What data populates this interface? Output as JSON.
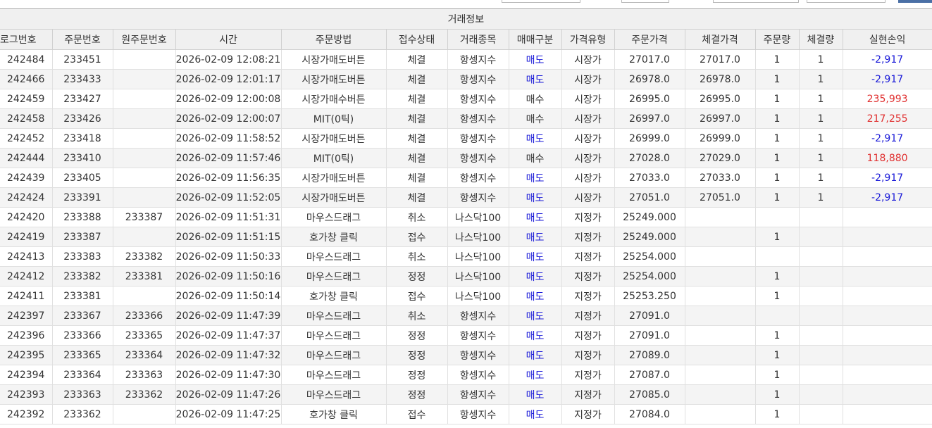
{
  "group_header": "거래정보",
  "columns": [
    "로그번호",
    "주문번호",
    "원주문번호",
    "시간",
    "주문방법",
    "접수상태",
    "거래종목",
    "매매구분",
    "가격유형",
    "주문가격",
    "체결가격",
    "주문량",
    "체결량",
    "실현손익"
  ],
  "colors": {
    "sell": "#1a1ad8",
    "profit_positive": "#e03030",
    "profit_negative": "#1a1ad8",
    "header_bg": "#f0f0f0",
    "row_alt_bg": "#f4f4f4"
  },
  "rows": [
    {
      "log": "242484",
      "order": "233451",
      "orig": "",
      "time": "2026-02-09 12:08:21",
      "method": "시장가매도버튼",
      "status": "체결",
      "symbol": "항셍지수",
      "side": "매도",
      "ptype": "시장가",
      "oprice": "27017.0",
      "fprice": "27017.0",
      "oqty": "1",
      "fqty": "1",
      "pnl": "-2,917"
    },
    {
      "log": "242466",
      "order": "233433",
      "orig": "",
      "time": "2026-02-09 12:01:17",
      "method": "시장가매도버튼",
      "status": "체결",
      "symbol": "항셍지수",
      "side": "매도",
      "ptype": "시장가",
      "oprice": "26978.0",
      "fprice": "26978.0",
      "oqty": "1",
      "fqty": "1",
      "pnl": "-2,917"
    },
    {
      "log": "242459",
      "order": "233427",
      "orig": "",
      "time": "2026-02-09 12:00:08",
      "method": "시장가매수버튼",
      "status": "체결",
      "symbol": "항셍지수",
      "side": "매수",
      "ptype": "시장가",
      "oprice": "26995.0",
      "fprice": "26995.0",
      "oqty": "1",
      "fqty": "1",
      "pnl": "235,993"
    },
    {
      "log": "242458",
      "order": "233426",
      "orig": "",
      "time": "2026-02-09 12:00:07",
      "method": "MIT(0틱)",
      "status": "체결",
      "symbol": "항셍지수",
      "side": "매수",
      "ptype": "시장가",
      "oprice": "26997.0",
      "fprice": "26997.0",
      "oqty": "1",
      "fqty": "1",
      "pnl": "217,255"
    },
    {
      "log": "242452",
      "order": "233418",
      "orig": "",
      "time": "2026-02-09 11:58:52",
      "method": "시장가매도버튼",
      "status": "체결",
      "symbol": "항셍지수",
      "side": "매도",
      "ptype": "시장가",
      "oprice": "26999.0",
      "fprice": "26999.0",
      "oqty": "1",
      "fqty": "1",
      "pnl": "-2,917"
    },
    {
      "log": "242444",
      "order": "233410",
      "orig": "",
      "time": "2026-02-09 11:57:46",
      "method": "MIT(0틱)",
      "status": "체결",
      "symbol": "항셍지수",
      "side": "매수",
      "ptype": "시장가",
      "oprice": "27028.0",
      "fprice": "27029.0",
      "oqty": "1",
      "fqty": "1",
      "pnl": "118,880"
    },
    {
      "log": "242439",
      "order": "233405",
      "orig": "",
      "time": "2026-02-09 11:56:35",
      "method": "시장가매도버튼",
      "status": "체결",
      "symbol": "항셍지수",
      "side": "매도",
      "ptype": "시장가",
      "oprice": "27033.0",
      "fprice": "27033.0",
      "oqty": "1",
      "fqty": "1",
      "pnl": "-2,917"
    },
    {
      "log": "242424",
      "order": "233391",
      "orig": "",
      "time": "2026-02-09 11:52:05",
      "method": "시장가매도버튼",
      "status": "체결",
      "symbol": "항셍지수",
      "side": "매도",
      "ptype": "시장가",
      "oprice": "27051.0",
      "fprice": "27051.0",
      "oqty": "1",
      "fqty": "1",
      "pnl": "-2,917"
    },
    {
      "log": "242420",
      "order": "233388",
      "orig": "233387",
      "time": "2026-02-09 11:51:31",
      "method": "마우스드래그",
      "status": "취소",
      "symbol": "나스닥100",
      "side": "매도",
      "ptype": "지정가",
      "oprice": "25249.000",
      "fprice": "",
      "oqty": "",
      "fqty": "",
      "pnl": ""
    },
    {
      "log": "242419",
      "order": "233387",
      "orig": "",
      "time": "2026-02-09 11:51:15",
      "method": "호가창 클릭",
      "status": "접수",
      "symbol": "나스닥100",
      "side": "매도",
      "ptype": "지정가",
      "oprice": "25249.000",
      "fprice": "",
      "oqty": "1",
      "fqty": "",
      "pnl": ""
    },
    {
      "log": "242413",
      "order": "233383",
      "orig": "233382",
      "time": "2026-02-09 11:50:33",
      "method": "마우스드래그",
      "status": "취소",
      "symbol": "나스닥100",
      "side": "매도",
      "ptype": "지정가",
      "oprice": "25254.000",
      "fprice": "",
      "oqty": "",
      "fqty": "",
      "pnl": ""
    },
    {
      "log": "242412",
      "order": "233382",
      "orig": "233381",
      "time": "2026-02-09 11:50:16",
      "method": "마우스드래그",
      "status": "정정",
      "symbol": "나스닥100",
      "side": "매도",
      "ptype": "지정가",
      "oprice": "25254.000",
      "fprice": "",
      "oqty": "1",
      "fqty": "",
      "pnl": ""
    },
    {
      "log": "242411",
      "order": "233381",
      "orig": "",
      "time": "2026-02-09 11:50:14",
      "method": "호가창 클릭",
      "status": "접수",
      "symbol": "나스닥100",
      "side": "매도",
      "ptype": "지정가",
      "oprice": "25253.250",
      "fprice": "",
      "oqty": "1",
      "fqty": "",
      "pnl": ""
    },
    {
      "log": "242397",
      "order": "233367",
      "orig": "233366",
      "time": "2026-02-09 11:47:39",
      "method": "마우스드래그",
      "status": "취소",
      "symbol": "항셍지수",
      "side": "매도",
      "ptype": "지정가",
      "oprice": "27091.0",
      "fprice": "",
      "oqty": "",
      "fqty": "",
      "pnl": ""
    },
    {
      "log": "242396",
      "order": "233366",
      "orig": "233365",
      "time": "2026-02-09 11:47:37",
      "method": "마우스드래그",
      "status": "정정",
      "symbol": "항셍지수",
      "side": "매도",
      "ptype": "지정가",
      "oprice": "27091.0",
      "fprice": "",
      "oqty": "1",
      "fqty": "",
      "pnl": ""
    },
    {
      "log": "242395",
      "order": "233365",
      "orig": "233364",
      "time": "2026-02-09 11:47:32",
      "method": "마우스드래그",
      "status": "정정",
      "symbol": "항셍지수",
      "side": "매도",
      "ptype": "지정가",
      "oprice": "27089.0",
      "fprice": "",
      "oqty": "1",
      "fqty": "",
      "pnl": ""
    },
    {
      "log": "242394",
      "order": "233364",
      "orig": "233363",
      "time": "2026-02-09 11:47:30",
      "method": "마우스드래그",
      "status": "정정",
      "symbol": "항셍지수",
      "side": "매도",
      "ptype": "지정가",
      "oprice": "27087.0",
      "fprice": "",
      "oqty": "1",
      "fqty": "",
      "pnl": ""
    },
    {
      "log": "242393",
      "order": "233363",
      "orig": "233362",
      "time": "2026-02-09 11:47:26",
      "method": "마우스드래그",
      "status": "정정",
      "symbol": "항셍지수",
      "side": "매도",
      "ptype": "지정가",
      "oprice": "27085.0",
      "fprice": "",
      "oqty": "1",
      "fqty": "",
      "pnl": ""
    },
    {
      "log": "242392",
      "order": "233362",
      "orig": "",
      "time": "2026-02-09 11:47:25",
      "method": "호가창 클릭",
      "status": "접수",
      "symbol": "항셍지수",
      "side": "매도",
      "ptype": "지정가",
      "oprice": "27084.0",
      "fprice": "",
      "oqty": "1",
      "fqty": "",
      "pnl": ""
    }
  ]
}
